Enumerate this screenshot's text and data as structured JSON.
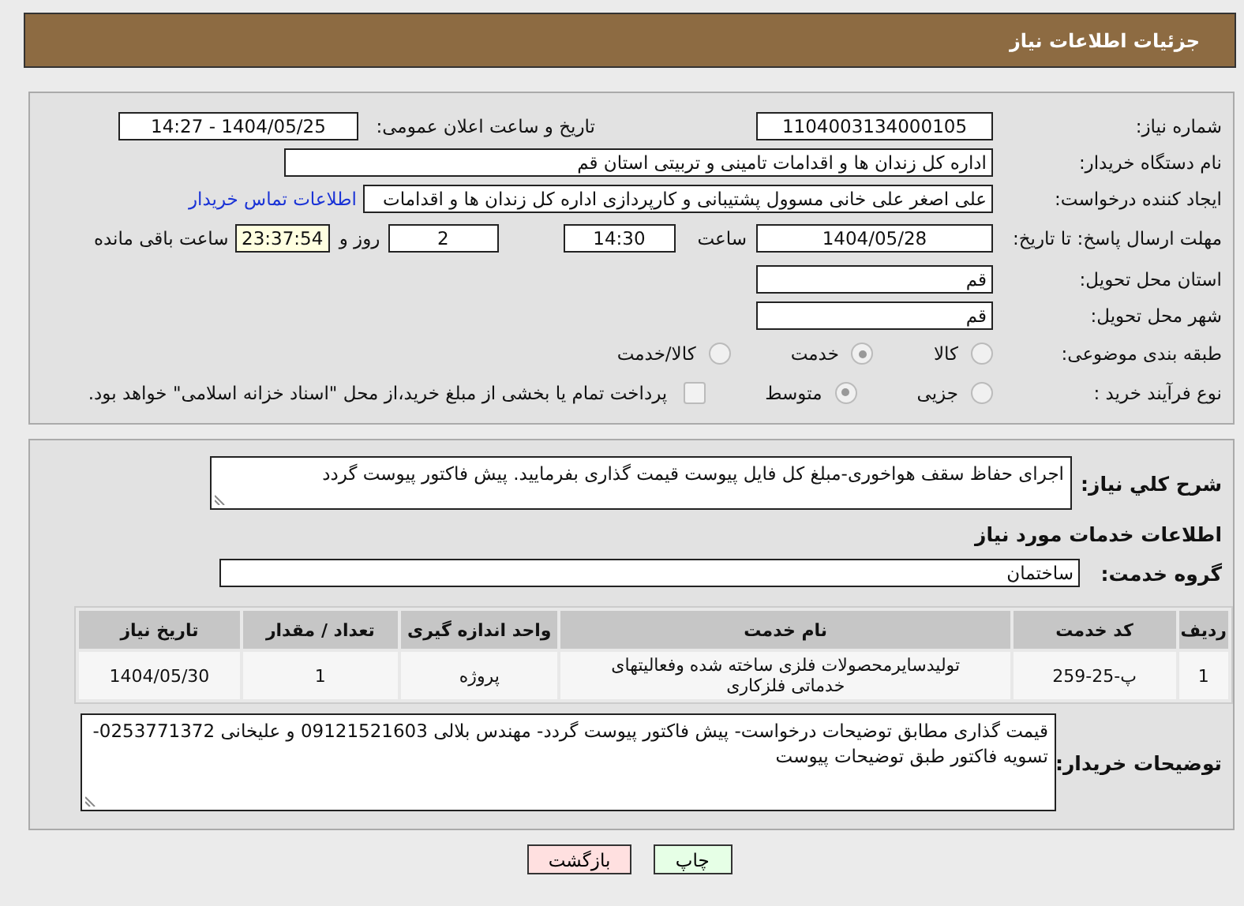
{
  "header": {
    "title": "جزئیات اطلاعات نیاز"
  },
  "need_number": {
    "label": "شماره نیاز:",
    "value": "1104003134000105"
  },
  "announce": {
    "label": "تاریخ و ساعت اعلان عمومی:",
    "value": "1404/05/25 - 14:27"
  },
  "buyer": {
    "label": "نام دستگاه خریدار:",
    "value": "اداره کل زندان ها و اقدامات تامینی و تربیتی استان قم"
  },
  "creator": {
    "label": "ایجاد کننده درخواست:",
    "value": "علی اصغر علی خانی مسوول پشتیبانی و کارپردازی اداره کل زندان ها و اقدامات",
    "link": "اطلاعات تماس خریدار"
  },
  "deadline": {
    "label": "مهلت ارسال پاسخ: تا تاریخ:",
    "date": "1404/05/28",
    "time_label": "ساعت",
    "time": "14:30",
    "days": "2",
    "days_label": "روز و",
    "remaining": "23:37:54",
    "remaining_label": "ساعت باقی مانده"
  },
  "province": {
    "label": "استان محل تحویل:",
    "value": "قم"
  },
  "city": {
    "label": "شهر محل تحویل:",
    "value": "قم"
  },
  "category": {
    "label": "طبقه بندی موضوعی:",
    "options": [
      {
        "label": "کالا",
        "selected": false
      },
      {
        "label": "خدمت",
        "selected": true
      },
      {
        "label": "کالا/خدمت",
        "selected": false
      }
    ]
  },
  "purchase_type": {
    "label": "نوع فرآیند خرید :",
    "options": [
      {
        "label": "جزیی",
        "selected": false
      },
      {
        "label": "متوسط",
        "selected": true
      }
    ],
    "payment": {
      "label": "پرداخت تمام یا بخشی از مبلغ خرید،از محل \"اسناد خزانه اسلامی\" خواهد بود.",
      "checked": false
    }
  },
  "description": {
    "label": "شرح کلي نیاز:",
    "value": "اجرای حفاظ سقف هواخوری-مبلغ کل فایل پیوست قیمت گذاری بفرمایید. پیش فاکتور پیوست گردد"
  },
  "services_title": "اطلاعات خدمات مورد نیاز",
  "service_group": {
    "label": "گروه خدمت:",
    "value": "ساختمان"
  },
  "table": {
    "columns": [
      "ردیف",
      "کد خدمت",
      "نام خدمت",
      "واحد اندازه گیری",
      "تعداد / مقدار",
      "تاریخ نیاز"
    ],
    "rows": [
      [
        "1",
        "پ-25-259",
        "تولیدسایرمحصولات فلزی ساخته شده وفعالیتهای خدماتی فلزکاری",
        "پروژه",
        "1",
        "1404/05/30"
      ]
    ]
  },
  "buyer_notes": {
    "label": "توضیحات خریدار:",
    "value": "قیمت گذاری مطابق توضیحات درخواست- پیش فاکتور پیوست گردد- مهندس بلالی 09121521603 و علیخانی 0253771372- تسویه فاکتور طبق توضیحات پیوست"
  },
  "buttons": [
    {
      "label": "چاپ",
      "kind": "print"
    },
    {
      "label": "بازگشت",
      "kind": "back"
    }
  ]
}
